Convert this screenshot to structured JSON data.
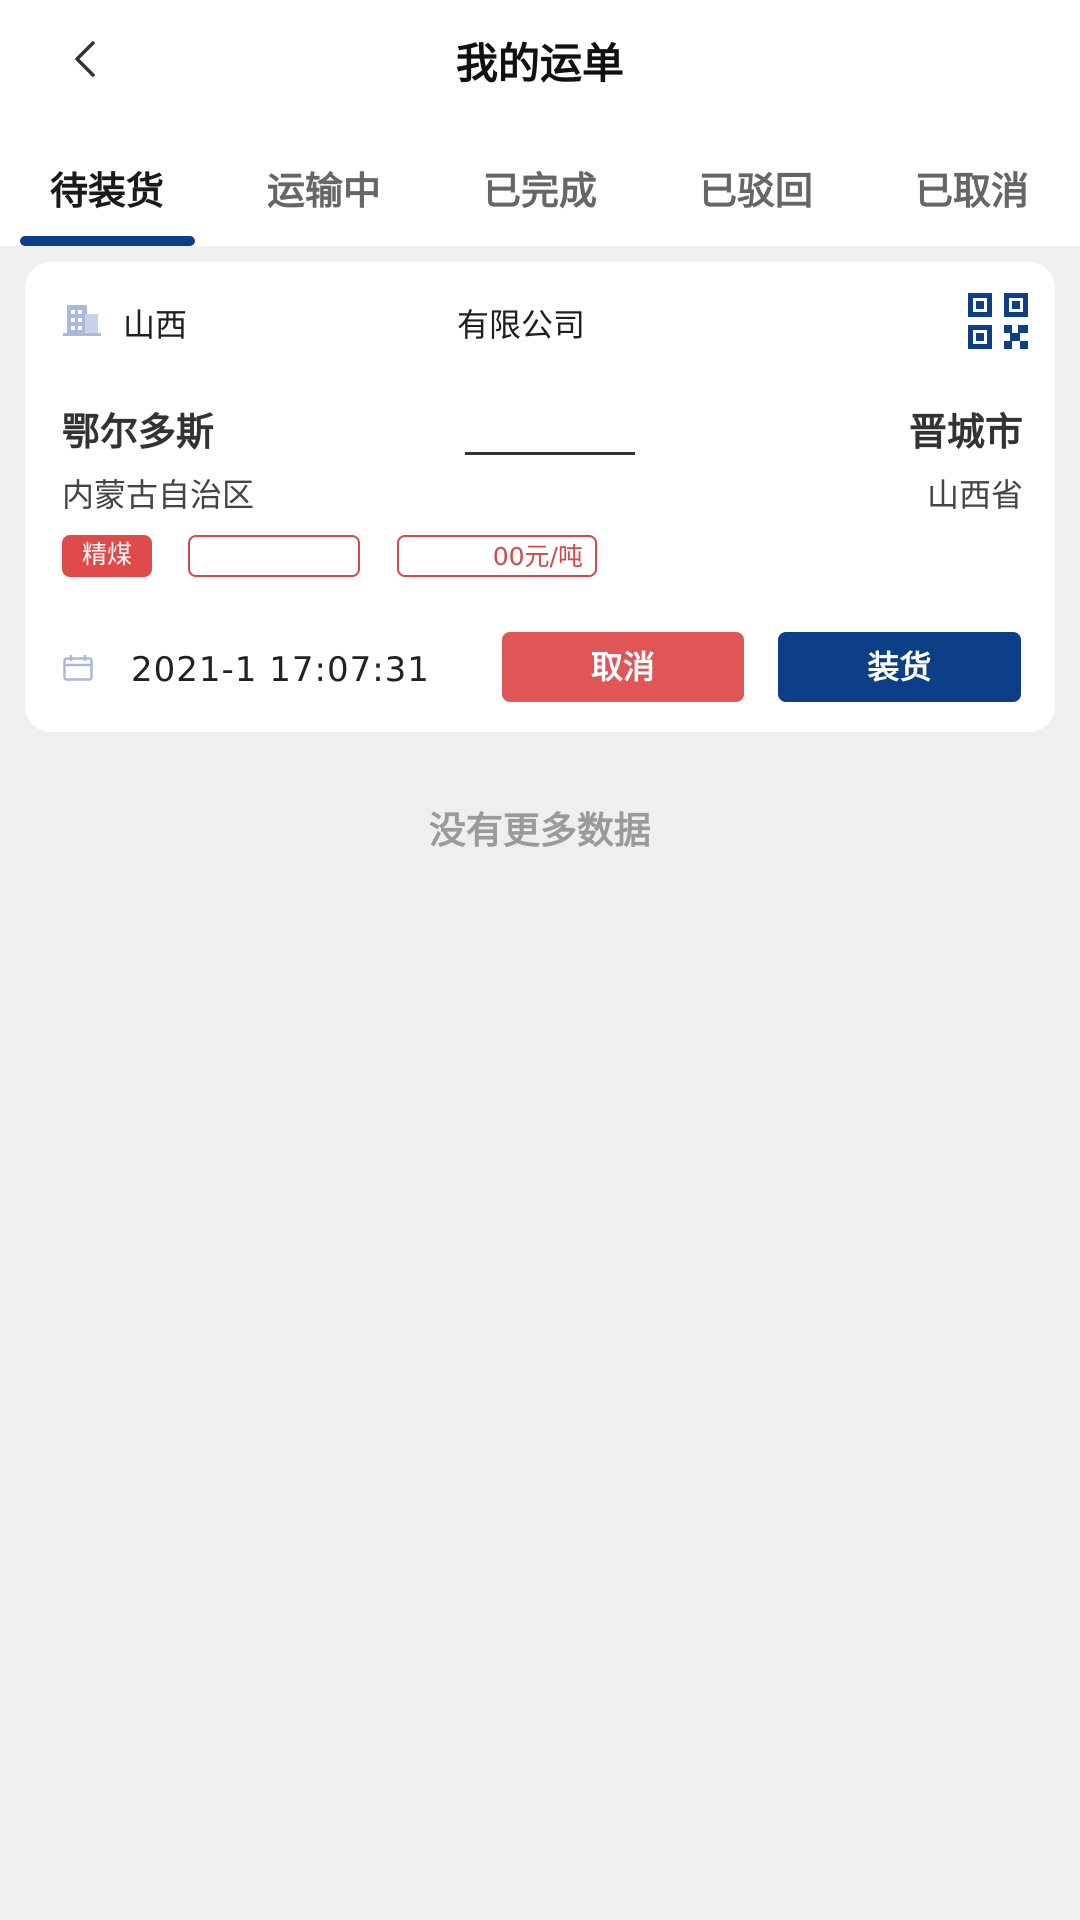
{
  "header": {
    "title": "我的运单"
  },
  "tabs": [
    {
      "label": "待装货"
    },
    {
      "label": "运输中"
    },
    {
      "label": "已完成"
    },
    {
      "label": "已驳回"
    },
    {
      "label": "已取消"
    }
  ],
  "active_tab": "待装货",
  "order": {
    "company_prefix": "山西",
    "company_suffix": "有限公司",
    "from_city": "鄂尔多斯",
    "from_province": "内蒙古自治区",
    "to_city": "晋城市",
    "to_province": "山西省",
    "tags": [
      "精煤",
      "",
      "00元/吨"
    ],
    "datetime": "2021-1 17:07:31",
    "cancel_label": "取消",
    "load_label": "装货"
  },
  "footer": {
    "no_more": "没有更多数据"
  },
  "colors": {
    "accent": "#0c3f86",
    "danger": "#e05656"
  }
}
